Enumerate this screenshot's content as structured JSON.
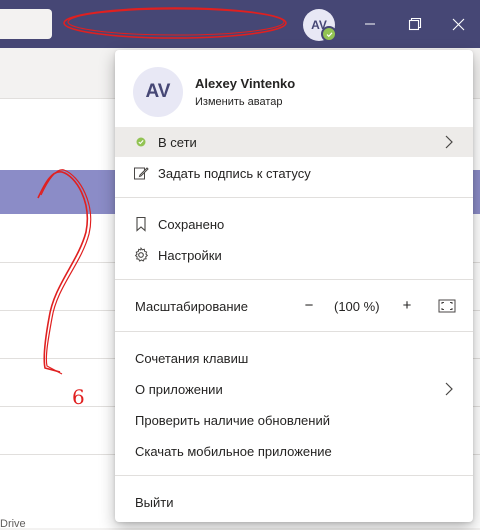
{
  "colors": {
    "titlebar": "#464775",
    "accent": "#6264a7",
    "presence": "#92c353",
    "annotation": "#e02020"
  },
  "titlebar": {
    "avatar_initials": "AV"
  },
  "profile": {
    "initials": "AV",
    "name": "Alexey Vintenko",
    "change_avatar": "Изменить аватар"
  },
  "menu": {
    "status": "В сети",
    "set_status_message": "Задать подпись к статусу",
    "saved": "Сохранено",
    "settings": "Настройки",
    "zoom_label": "Масштабирование",
    "zoom_minus": "−",
    "zoom_value": "(100 %)",
    "zoom_plus": "+",
    "shortcuts": "Сочетания клавиш",
    "about": "О приложении",
    "check_updates": "Проверить наличие обновлений",
    "download_mobile": "Скачать мобильное приложение",
    "sign_out": "Выйти"
  },
  "background": {
    "footnote": "Drive"
  },
  "annotation": {
    "mark": "6"
  }
}
